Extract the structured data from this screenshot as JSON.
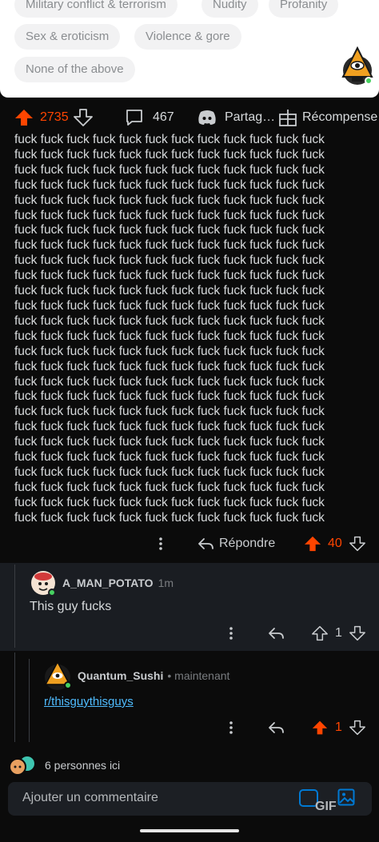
{
  "poll": {
    "options": [
      "Military conflict & terrorism",
      "Nudity",
      "Profanity",
      "Sex & eroticism",
      "Violence & gore",
      "None of the above"
    ]
  },
  "post_actions": {
    "score": "2735",
    "comments": "467",
    "share_label": "Partag…",
    "award_label": "Récompense"
  },
  "post_body": {
    "lines": [
      "fuck fuck fuck fuck fuck fuck fuck fuck fuck fuck fuck fuck",
      "fuck fuck fuck fuck fuck fuck fuck fuck fuck fuck fuck fuck",
      "fuck fuck fuck fuck fuck fuck fuck fuck fuck fuck fuck fuck",
      "fuck fuck fuck fuck fuck fuck fuck fuck fuck fuck fuck fuck",
      "fuck fuck fuck fuck fuck fuck fuck fuck fuck fuck fuck fuck",
      "fuck fuck fuck fuck fuck fuck fuck fuck fuck fuck fuck fuck",
      "fuck fuck fuck fuck fuck fuck fuck fuck fuck fuck fuck fuck",
      "fuck fuck fuck fuck fuck fuck fuck fuck fuck fuck fuck fuck",
      "fuck fuck fuck fuck fuck fuck fuck fuck fuck fuck fuck fuck",
      "fuck fuck fuck fuck fuck fuck fuck fuck fuck fuck fuck fuck",
      "fuck fuck fuck fuck fuck fuck fuck fuck fuck fuck fuck fuck",
      "fuck fuck fuck fuck fuck fuck fuck fuck fuck fuck fuck fuck",
      "fuck fuck fuck fuck fuck fuck fuck fuck fuck fuck fuck fuck",
      "fuck fuck fuck fuck fuck fuck fuck fuck fuck fuck fuck fuck",
      "fuck fuck fuck fuck fuck fuck fuck fuck fuck fuck fuck fuck",
      "fuck fuck fuck fuck fuck fuck fuck fuck fuck fuck fuck fuck",
      "fuck fuck fuck fuck fuck fuck fuck fuck fuck fuck fuck fuck",
      "fuck fuck fuck fuck fuck fuck fuck fuck fuck fuck fuck fuck",
      "fuck fuck fuck fuck fuck fuck fuck fuck fuck fuck fuck fuck",
      "fuck fuck fuck fuck fuck fuck fuck fuck fuck fuck fuck fuck",
      "fuck fuck fuck fuck fuck fuck fuck fuck fuck fuck fuck fuck",
      "fuck fuck fuck fuck fuck fuck fuck fuck fuck fuck fuck fuck",
      "fuck fuck fuck fuck fuck fuck fuck fuck fuck fuck fuck fuck",
      "fuck fuck fuck fuck fuck fuck fuck fuck fuck fuck fuck fuck",
      "fuck fuck fuck fuck fuck fuck fuck fuck fuck fuck fuck fuck",
      "fuck fuck fuck fuck fuck fuck fuck fuck fuck fuck fuck fuck"
    ]
  },
  "body_actions": {
    "reply_label": "Répondre",
    "score": "40"
  },
  "comment1": {
    "username": "A_MAN_POTATO",
    "time": "1m",
    "text": "This guy fucks",
    "score": "1"
  },
  "comment2": {
    "username": "Quantum_Sushi",
    "time": "• maintenant",
    "link": "r/thisguythisguys",
    "score": "1"
  },
  "presence": {
    "text": "6 personnes ici"
  },
  "composer": {
    "placeholder": "Ajouter un commentaire",
    "gif_label": "GIF"
  },
  "colors": {
    "upvote": "#ff4500",
    "link": "#4fbcff",
    "accent": "#0079d3",
    "online": "#46d160"
  }
}
